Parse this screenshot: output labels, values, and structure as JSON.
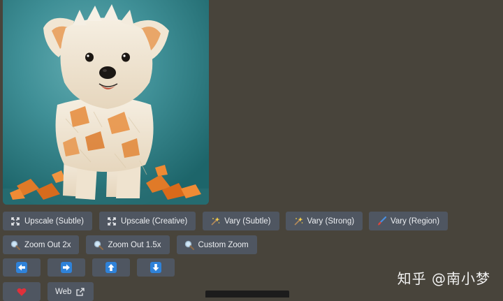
{
  "image": {
    "subject": "paper-dog-image"
  },
  "row1": [
    {
      "label": "Upscale (Subtle)",
      "icon": "expand-icon"
    },
    {
      "label": "Upscale (Creative)",
      "icon": "expand-icon"
    },
    {
      "label": "Vary (Subtle)",
      "icon": "sparkle-wand-icon"
    },
    {
      "label": "Vary (Strong)",
      "icon": "sparkle-wand-icon"
    },
    {
      "label": "Vary (Region)",
      "icon": "paintbrush-icon"
    }
  ],
  "row2": [
    {
      "label": "Zoom Out 2x",
      "icon": "magnifier-icon"
    },
    {
      "label": "Zoom Out 1.5x",
      "icon": "magnifier-icon"
    },
    {
      "label": "Custom Zoom",
      "icon": "magnifier-icon"
    }
  ],
  "row3": [
    {
      "icon": "arrow-left-icon"
    },
    {
      "icon": "arrow-right-icon"
    },
    {
      "icon": "arrow-up-icon"
    },
    {
      "icon": "arrow-down-icon"
    }
  ],
  "row4": {
    "favorite_icon": "heart-icon",
    "web_label": "Web",
    "web_icon": "external-link-icon"
  },
  "watermark": "知乎 @南小梦",
  "colors": {
    "background": "#48443b",
    "button": "#4f5661",
    "arrow_blue": "#2f82d9",
    "heart_red": "#e0303a"
  }
}
